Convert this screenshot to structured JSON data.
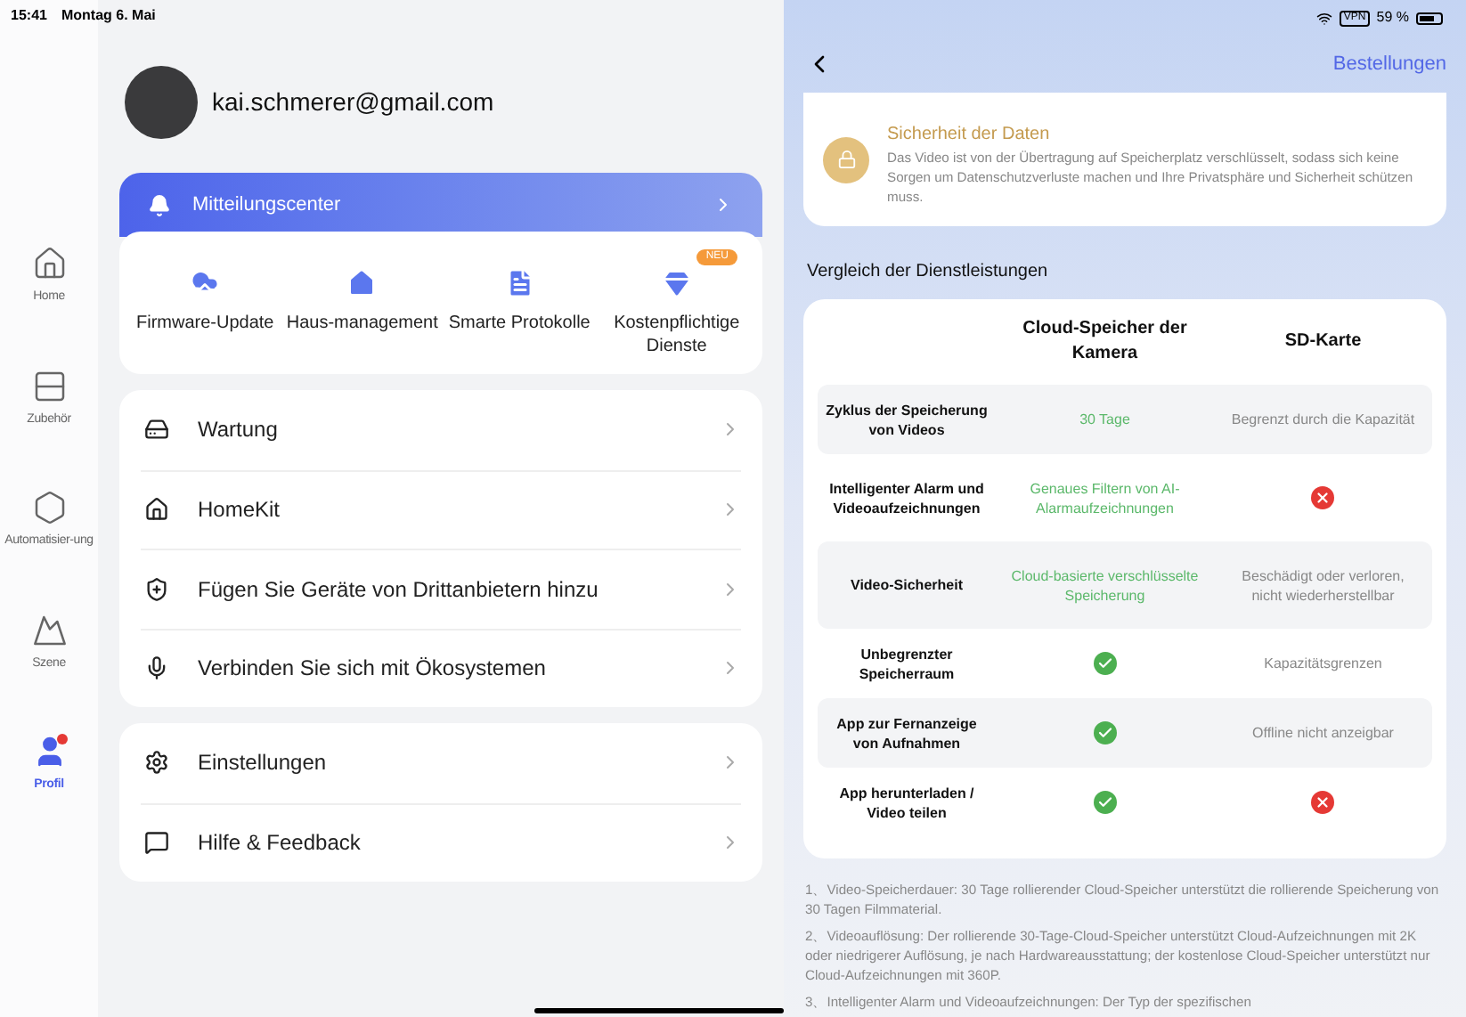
{
  "status_bar": {
    "time": "15:41",
    "date": "Montag 6. Mai",
    "vpn": "VPN",
    "battery": "59 %"
  },
  "sidebar": {
    "items": [
      {
        "label": "Home",
        "selected": false,
        "badge": false
      },
      {
        "label": "Zubehör",
        "selected": false,
        "badge": false
      },
      {
        "label": "Automatisier-ung",
        "selected": false,
        "badge": false
      },
      {
        "label": "Szene",
        "selected": false,
        "badge": false
      },
      {
        "label": "Profil",
        "selected": true,
        "badge": true
      }
    ]
  },
  "profile": {
    "email": "kai.schmerer@gmail.com"
  },
  "notification_center": {
    "label": "Mitteilungscenter"
  },
  "quick_actions": [
    {
      "label": "Firmware-Update"
    },
    {
      "label": "Haus-management"
    },
    {
      "label": "Smarte Protokolle"
    },
    {
      "label": "Kostenpflichtige Dienste",
      "badge": "NEU"
    }
  ],
  "menu_groups": [
    [
      {
        "label": "Wartung"
      },
      {
        "label": "HomeKit"
      },
      {
        "label": "Fügen Sie Geräte von Drittanbietern hinzu"
      },
      {
        "label": "Verbinden Sie sich mit Ökosystemen"
      }
    ],
    [
      {
        "label": "Einstellungen"
      },
      {
        "label": "Hilfe & Feedback"
      }
    ]
  ],
  "detail": {
    "orders": "Bestellungen",
    "feature": {
      "title": "Sicherheit der Daten",
      "text": "Das Video ist von der Übertragung auf Speicherplatz verschlüsselt, sodass sich keine Sorgen um Datenschutzverluste machen und Ihre Privatsphäre und Sicherheit schützen muss."
    },
    "comparison_title": "Vergleich der Dienstleistungen",
    "table": {
      "columns": [
        "Cloud-Speicher der Kamera",
        "SD-Karte"
      ],
      "rows": [
        {
          "label": "Zyklus der Speicherung von Videos",
          "cells": [
            {
              "kind": "text",
              "text": "30 Tage"
            },
            {
              "kind": "text",
              "text": "Begrenzt durch die Kapazität"
            }
          ]
        },
        {
          "label": "Intelligenter Alarm und Videoaufzeichnungen",
          "cells": [
            {
              "kind": "text",
              "text": "Genaues Filtern von AI-Alarmaufzeichnungen"
            },
            {
              "kind": "cross"
            }
          ]
        },
        {
          "label": "Video-Sicherheit",
          "cells": [
            {
              "kind": "text",
              "text": "Cloud-basierte verschlüsselte Speicherung"
            },
            {
              "kind": "text",
              "text": "Beschädigt oder verloren, nicht wiederherstellbar"
            }
          ]
        },
        {
          "label": "Unbegrenzter Speicherraum",
          "cells": [
            {
              "kind": "check"
            },
            {
              "kind": "text",
              "text": "Kapazitätsgrenzen"
            }
          ]
        },
        {
          "label": "App zur Fernanzeige von Aufnahmen",
          "cells": [
            {
              "kind": "check"
            },
            {
              "kind": "text",
              "text": "Offline nicht anzeigbar"
            }
          ]
        },
        {
          "label": "App herunterladen / Video teilen",
          "cells": [
            {
              "kind": "check"
            },
            {
              "kind": "cross"
            }
          ]
        }
      ]
    },
    "notes": [
      "1、Video-Speicherdauer: 30 Tage rollierender Cloud-Speicher unterstützt die rollierende Speicherung von 30 Tagen Filmmaterial.",
      "2、Videoauflösung: Der rollierende 30-Tage-Cloud-Speicher unterstützt Cloud-Aufzeichnungen mit 2K oder niedrigerer Auflösung, je nach Hardwareausstattung; der kostenlose Cloud-Speicher unterstützt nur Cloud-Aufzeichnungen mit 360P.",
      "3、Intelligenter Alarm und Videoaufzeichnungen: Der Typ der spezifischen"
    ]
  }
}
